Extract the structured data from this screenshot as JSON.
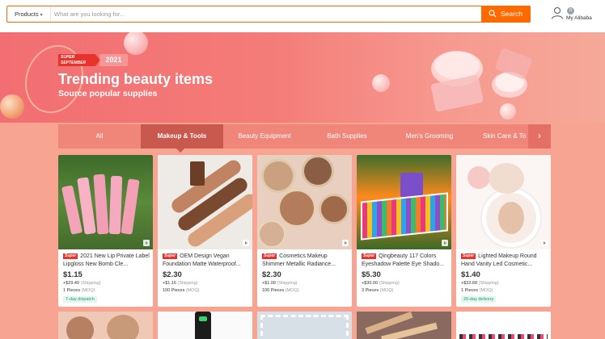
{
  "header": {
    "category": "Products",
    "search_placeholder": "What are you looking for...",
    "search_button": "Search",
    "badge_count": "0",
    "my_alibaba": "My Alibaba"
  },
  "banner": {
    "tag_line1": "SUPER",
    "tag_line2": "SEPTEMBER",
    "year": "2021",
    "title": "Trending beauty items",
    "subtitle": "Source popular supplies"
  },
  "tabs": [
    {
      "label": "All"
    },
    {
      "label": "Makeup & Tools"
    },
    {
      "label": "Beauty Equipment"
    },
    {
      "label": "Bath Supplies"
    },
    {
      "label": "Men's Grooming"
    },
    {
      "label": "Skin Care & To"
    }
  ],
  "tab_next": "›",
  "products": [
    {
      "super": "Super",
      "name": "2021 New Lip Private Label Lipgloss New Bomb Cle...",
      "price": "$1.15",
      "shipping": "+$29.40",
      "shipping_label": "(Shipping)",
      "moq": "1 Pieces",
      "moq_label": "(MOQ)",
      "tag": "7-day dispatch"
    },
    {
      "super": "Super",
      "name": "OEM Design Vegan Foundation Matte Waterproof...",
      "price": "$2.30",
      "shipping": "+$1.16",
      "shipping_label": "(Shipping)",
      "moq": "100 Pieces",
      "moq_label": "(MOQ)",
      "tag": ""
    },
    {
      "super": "Super",
      "name": "Cosmetics Makeup Shimmer Metallic Radiance...",
      "price": "$2.30",
      "shipping": "+$1.09",
      "shipping_label": "(Shipping)",
      "moq": "100 Pieces",
      "moq_label": "(MOQ)",
      "tag": ""
    },
    {
      "super": "Super",
      "name": "Qingbeauty 117 Colors Eyeshadow Palette Eye Shado...",
      "price": "$5.30",
      "shipping": "+$30.00",
      "shipping_label": "(Shipping)",
      "moq": "3 Pieces",
      "moq_label": "(MOQ)",
      "tag": ""
    },
    {
      "super": "Super",
      "name": "Lighted Makeup Round Hand Vanity Led Cosmetic...",
      "price": "$1.40",
      "shipping": "+$32.68",
      "shipping_label": "(Shipping)",
      "moq": "1 Pieces",
      "moq_label": "(MOQ)",
      "tag": "20-day delivery"
    }
  ],
  "colors": {
    "accent": "#ff6a00",
    "super_red": "#e8332c",
    "tab_active": "#c9584e",
    "tag_green": "#1e9c6e"
  },
  "icons": [
    "chevron-down-icon",
    "search-icon",
    "user-icon",
    "play-icon",
    "chevron-right-icon"
  ]
}
